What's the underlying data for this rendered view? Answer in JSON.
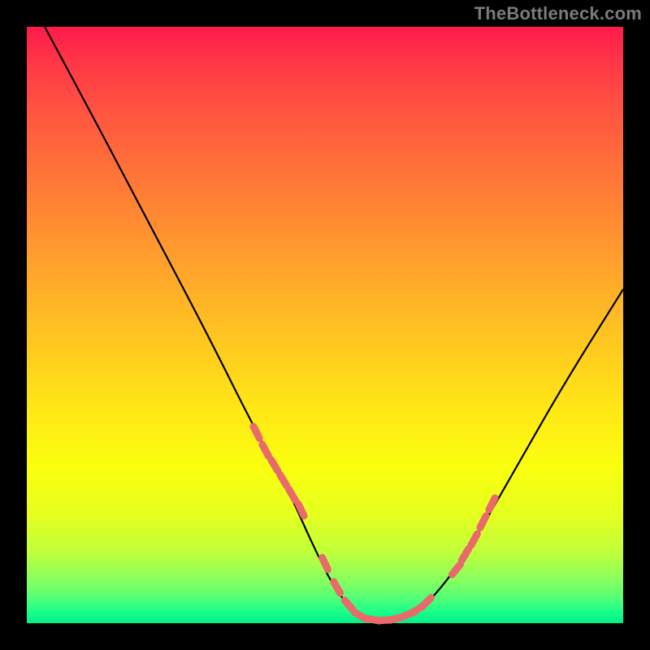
{
  "watermark": "TheBottleneck.com",
  "chart_data": {
    "type": "line",
    "title": "",
    "xlabel": "",
    "ylabel": "",
    "xlim": [
      0,
      100
    ],
    "ylim": [
      0,
      100
    ],
    "grid": false,
    "legend": false,
    "series": [
      {
        "name": "bottleneck-curve",
        "color": "#000000",
        "style": "solid",
        "x": [
          3,
          10,
          20,
          30,
          38,
          44,
          48,
          52,
          56,
          60,
          64,
          68,
          74,
          82,
          90,
          100
        ],
        "y": [
          100,
          87,
          68,
          49,
          33,
          22,
          13,
          5,
          1,
          0.5,
          1,
          4,
          12,
          26,
          40,
          56
        ]
      },
      {
        "name": "highlight-dots",
        "color": "#e97070",
        "style": "markers",
        "x": [
          38.5,
          40,
          41.5,
          43,
          44.5,
          46,
          50,
          52,
          54,
          56,
          58,
          60,
          62,
          64,
          65.5,
          67,
          72,
          73.5,
          75,
          76.5,
          78
        ],
        "y": [
          32,
          29,
          26.5,
          24,
          21.5,
          19,
          10,
          6,
          3,
          1.2,
          0.6,
          0.5,
          0.8,
          1.5,
          2.3,
          3.5,
          9,
          11.5,
          14,
          17,
          20
        ]
      }
    ],
    "note": "x and y values are estimated percentages of the inner plot width/height; y=0 is the bottom edge"
  }
}
